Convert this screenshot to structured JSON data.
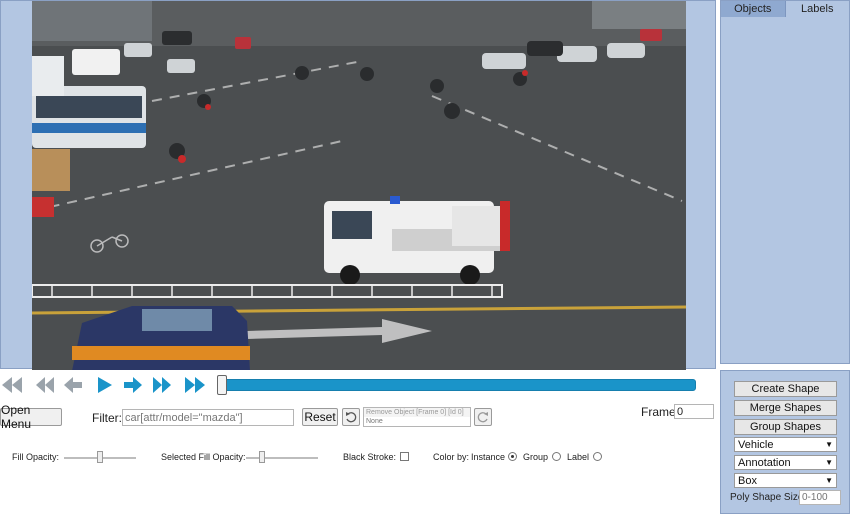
{
  "objects_panel": {
    "tabs": [
      {
        "label": "Objects",
        "active": true
      },
      {
        "label": "Labels",
        "active": false
      }
    ]
  },
  "playback": {
    "buttons": [
      "skip-to-start",
      "step-back-large",
      "step-back",
      "play",
      "step-forward",
      "step-forward-large",
      "skip-to-end"
    ],
    "accent_color": "#1a94c9"
  },
  "toolbar": {
    "open_menu_label": "Open Menu",
    "filter_label": "Filter:",
    "filter_value": "car[attr/model=\"mazda\"]",
    "reset_label": "Reset",
    "remove_object_label": "Remove Object [Frame 0] [Id 0]",
    "remove_object_value": "None",
    "frame_label": "Frame",
    "frame_value": "0"
  },
  "options": {
    "fill_opacity_label": "Fill Opacity:",
    "selected_fill_opacity_label": "Selected Fill Opacity:",
    "black_stroke_label": "Black Stroke:",
    "color_by_label": "Color by:",
    "color_by_options": [
      {
        "label": "Instance",
        "selected": true
      },
      {
        "label": "Group",
        "selected": false
      },
      {
        "label": "Label",
        "selected": false
      }
    ]
  },
  "tools": {
    "create_shape_label": "Create Shape",
    "merge_shapes_label": "Merge Shapes",
    "group_shapes_label": "Group Shapes",
    "label_select": "Vehicle",
    "mode_select": "Annotation",
    "shape_select": "Box",
    "poly_size_label": "Poly Shape Size:",
    "poly_size_placeholder": "0-100"
  }
}
